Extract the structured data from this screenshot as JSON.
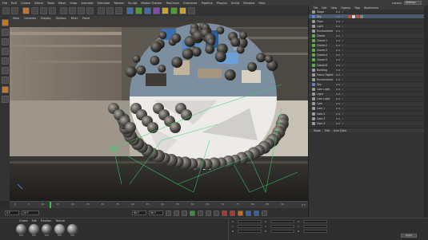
{
  "menubar": {
    "items": [
      "File",
      "Edit",
      "Create",
      "Select",
      "Tools",
      "Mesh",
      "Snap",
      "Animate",
      "Simulate",
      "Render",
      "Sculpt",
      "Motion Tracker",
      "MoGraph",
      "Character",
      "Pipeline",
      "Plugins",
      "Script",
      "Window",
      "Help"
    ],
    "layout_label": "Layout:",
    "layout_value": "Startup"
  },
  "viewport": {
    "menu": [
      "View",
      "Cameras",
      "Display",
      "Options",
      "Filter",
      "Panel"
    ]
  },
  "timeline": {
    "ticks": [
      "0",
      "5",
      "10",
      "15",
      "20",
      "25",
      "30",
      "35",
      "40",
      "45",
      "50",
      "55",
      "60",
      "65",
      "70",
      "75",
      "80",
      "85",
      "90"
    ],
    "end_frame": "0 F",
    "current_frame": "20 F"
  },
  "transport": {
    "start_field": "0 F",
    "current_field": "20 F",
    "end_field": "90 F",
    "max_field": "90 F"
  },
  "material_panel": {
    "menu": [
      "Create",
      "Edit",
      "Function",
      "Texture"
    ],
    "materials": [
      {
        "name": "Mat",
        "color": "#5a5a5a"
      },
      {
        "name": "Mat",
        "color": "#6a6a6a"
      },
      {
        "name": "Mat",
        "color": "#505050"
      },
      {
        "name": "Mat",
        "color": "#7a7a7a"
      },
      {
        "name": "Mat",
        "color": "#646464"
      }
    ]
  },
  "coord_panel": {
    "rows": [
      {
        "axis": "X"
      },
      {
        "axis": "Y"
      },
      {
        "axis": "Z"
      }
    ],
    "apply_label": "Apply"
  },
  "object_manager": {
    "tabs": [
      "File",
      "Edit",
      "View",
      "Objects",
      "Tags",
      "Bookmarks"
    ],
    "objects": [
      {
        "name": "Stage",
        "icon": "grey"
      },
      {
        "name": "Sky",
        "icon": "blue"
      },
      {
        "name": "Floor",
        "icon": "grey"
      },
      {
        "name": "Light",
        "icon": "grey"
      },
      {
        "name": "Environment",
        "icon": "grey"
      },
      {
        "name": "Cloner",
        "icon": "green"
      },
      {
        "name": "Cloner.1",
        "icon": "green"
      },
      {
        "name": "Cloner.2",
        "icon": "green"
      },
      {
        "name": "Cloner.3",
        "icon": "green"
      },
      {
        "name": "Cloner.4",
        "icon": "green"
      },
      {
        "name": "Cloner.5",
        "icon": "green"
      },
      {
        "name": "Cloner.6",
        "icon": "green"
      },
      {
        "name": "Building",
        "icon": "grey"
      },
      {
        "name": "Focus Object",
        "icon": "grey"
      },
      {
        "name": "Environment",
        "icon": "grey"
      },
      {
        "name": "Sky",
        "icon": "blue"
      },
      {
        "name": "Cam Light",
        "icon": "grey"
      },
      {
        "name": "Light",
        "icon": "grey"
      },
      {
        "name": "Cam Light",
        "icon": "grey"
      },
      {
        "name": "Cam",
        "icon": "grey"
      },
      {
        "name": "Cam.1",
        "icon": "grey"
      },
      {
        "name": "Cam.2",
        "icon": "grey"
      },
      {
        "name": "Cam.3",
        "icon": "grey"
      },
      {
        "name": "Cam.4",
        "icon": "grey"
      }
    ]
  },
  "attribute_manager": {
    "tabs": [
      "Mode",
      "Edit",
      "User Data"
    ]
  },
  "colors": {
    "accent_orange": "#c9741e",
    "check_green": "#66c24a",
    "guide_green": "#38d36a"
  }
}
